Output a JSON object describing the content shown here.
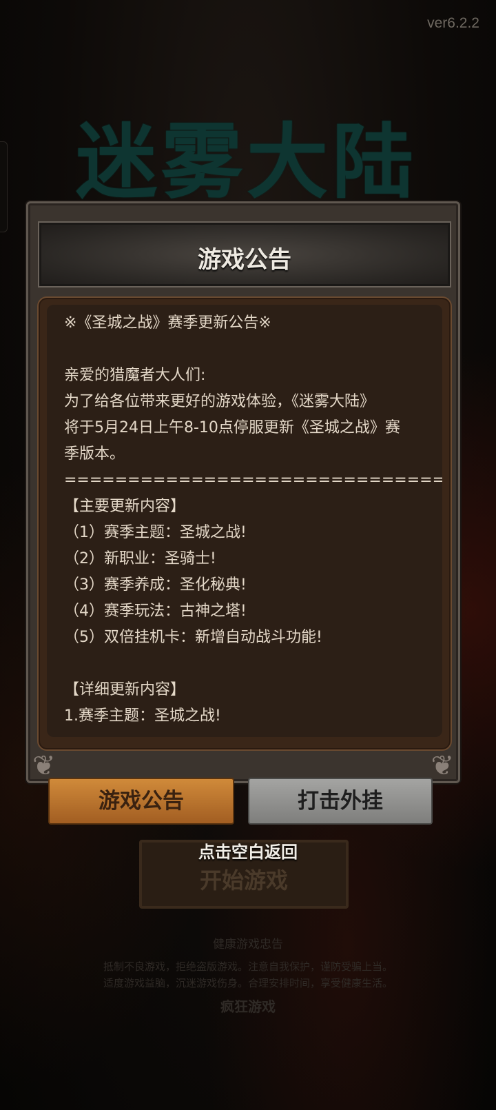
{
  "version": "ver6.2.2",
  "logo_text": "迷雾大陆",
  "dialog": {
    "title": "游戏公告",
    "lines": [
      "※《圣城之战》赛季更新公告※",
      "",
      "亲爱的猎魔者大人们:",
      "为了给各位带来更好的游戏体验，《迷雾大陆》",
      "将于5月24日上午8-10点停服更新《圣城之战》赛",
      "季版本。",
      "====================================",
      "【主要更新内容】",
      "（1）赛季主题：圣城之战!",
      "（2）新职业：圣骑士!",
      "（3）赛季养成：圣化秘典!",
      "（4）赛季玩法：古神之塔!",
      "（5）双倍挂机卡：新增自动战斗功能!",
      "",
      "【详细更新内容】",
      "1.赛季主题：圣城之战!"
    ]
  },
  "tabs": {
    "announcement": "游戏公告",
    "anti_cheat": "打击外挂"
  },
  "back_hint": "点击空白返回",
  "start_button": "开始游戏",
  "footer": {
    "heading": "健康游戏忠告",
    "line1": "抵制不良游戏，拒绝盗版游戏。注意自我保护，谨防受骗上当。",
    "line2": "适度游戏益脑，沉迷游戏伤身。合理安排时间，享受健康生活。",
    "logo": "疯狂游戏"
  },
  "colors": {
    "panel": "#3b342e",
    "content_bg": "#2c1f16",
    "text": "#e4d8c8",
    "accent_tab": "#c07a30",
    "inactive_tab": "#949492",
    "logo_teal": "#0e3531"
  }
}
